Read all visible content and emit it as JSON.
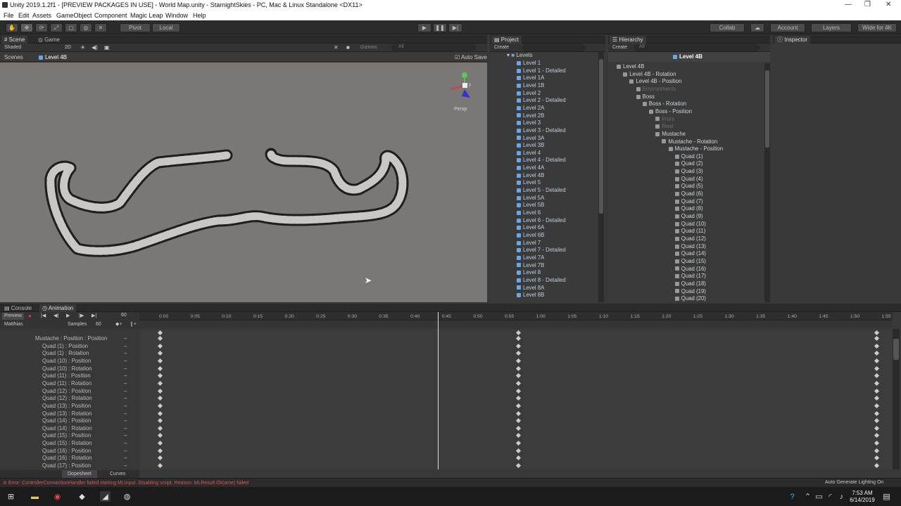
{
  "window": {
    "title": "Unity 2019.1.2f1 - [PREVIEW PACKAGES IN USE] - World Map.unity - StarnightSkies - PC, Mac & Linux Standalone <DX11>"
  },
  "menu": [
    "File",
    "Edit",
    "Assets",
    "GameObject",
    "Component",
    "Magic Leap",
    "Window",
    "Help"
  ],
  "toolbar": {
    "pivot": "Pivot",
    "local": "Local",
    "collab": "Collab",
    "account": "Account",
    "layers": "Layers",
    "layout": "Wide for 4K"
  },
  "scene": {
    "tabs": [
      "Scene",
      "Game"
    ],
    "shading": "Shaded",
    "mode2d": "2D",
    "gizmos": "Gizmos",
    "search": "All",
    "breadcrumb_root": "Scenes",
    "breadcrumb_current": "Level 4B",
    "autosave": "Auto Save",
    "persp": "Persp"
  },
  "project": {
    "tab": "Project",
    "create": "Create",
    "folder": "Levels",
    "items": [
      "Level 1",
      "Level 1 - Detailed",
      "Level 1A",
      "Level 1B",
      "Level 2",
      "Level 2 - Detailed",
      "Level 2A",
      "Level 2B",
      "Level 3",
      "Level 3 - Detailed",
      "Level 3A",
      "Level 3B",
      "Level 4",
      "Level 4 - Detailed",
      "Level 4A",
      "Level 4B",
      "Level 5",
      "Level 5 - Detailed",
      "Level 5A",
      "Level 5B",
      "Level 6",
      "Level 6 - Detailed",
      "Level 6A",
      "Level 6B",
      "Level 7",
      "Level 7 - Detailed",
      "Level 7A",
      "Level 7B",
      "Level 8",
      "Level 8 - Detailed",
      "Level 8A",
      "Level 8B"
    ]
  },
  "hierarchy": {
    "tab": "Hierarchy",
    "create": "Create",
    "search": "All",
    "header": "Level 4B",
    "items": [
      {
        "label": "Level 4B",
        "indent": 0,
        "dim": false
      },
      {
        "label": "Level 4B - Rotation",
        "indent": 1,
        "dim": false
      },
      {
        "label": "Level 4B - Position",
        "indent": 2,
        "dim": false
      },
      {
        "label": "Environments",
        "indent": 3,
        "dim": true
      },
      {
        "label": "Boss",
        "indent": 3,
        "dim": false
      },
      {
        "label": "Boss - Rotation",
        "indent": 4,
        "dim": false
      },
      {
        "label": "Boss - Position",
        "indent": 5,
        "dim": false
      },
      {
        "label": "Front",
        "indent": 6,
        "dim": true
      },
      {
        "label": "Rear",
        "indent": 6,
        "dim": true
      },
      {
        "label": "Mustache",
        "indent": 6,
        "dim": false
      },
      {
        "label": "Mustache - Rotation",
        "indent": 7,
        "dim": false
      },
      {
        "label": "Mustache - Position",
        "indent": 8,
        "dim": false
      },
      {
        "label": "Quad (1)",
        "indent": 9,
        "dim": false
      },
      {
        "label": "Quad (2)",
        "indent": 9,
        "dim": false
      },
      {
        "label": "Quad (3)",
        "indent": 9,
        "dim": false
      },
      {
        "label": "Quad (4)",
        "indent": 9,
        "dim": false
      },
      {
        "label": "Quad (5)",
        "indent": 9,
        "dim": false
      },
      {
        "label": "Quad (6)",
        "indent": 9,
        "dim": false
      },
      {
        "label": "Quad (7)",
        "indent": 9,
        "dim": false
      },
      {
        "label": "Quad (8)",
        "indent": 9,
        "dim": false
      },
      {
        "label": "Quad (9)",
        "indent": 9,
        "dim": false
      },
      {
        "label": "Quad (10)",
        "indent": 9,
        "dim": false
      },
      {
        "label": "Quad (11)",
        "indent": 9,
        "dim": false
      },
      {
        "label": "Quad (12)",
        "indent": 9,
        "dim": false
      },
      {
        "label": "Quad (13)",
        "indent": 9,
        "dim": false
      },
      {
        "label": "Quad (14)",
        "indent": 9,
        "dim": false
      },
      {
        "label": "Quad (15)",
        "indent": 9,
        "dim": false
      },
      {
        "label": "Quad (16)",
        "indent": 9,
        "dim": false
      },
      {
        "label": "Quad (17)",
        "indent": 9,
        "dim": false
      },
      {
        "label": "Quad (18)",
        "indent": 9,
        "dim": false
      },
      {
        "label": "Quad (19)",
        "indent": 9,
        "dim": false
      },
      {
        "label": "Quad (20)",
        "indent": 9,
        "dim": false
      }
    ]
  },
  "inspector": {
    "tab": "Inspector"
  },
  "animation": {
    "tabs": [
      "Console",
      "Animation"
    ],
    "preview": "Preview",
    "frame": "60",
    "clip": "Matthias",
    "samples_label": "Samples",
    "samples": "60",
    "tracks": [
      "Mustache : Position : Position",
      "Quad (1) : Position",
      "Quad (1) : Rotation",
      "Quad (10) : Position",
      "Quad (10) : Rotation",
      "Quad (11) : Position",
      "Quad (11) : Rotation",
      "Quad (12) : Position",
      "Quad (12) : Rotation",
      "Quad (13) : Position",
      "Quad (13) : Rotation",
      "Quad (14) : Position",
      "Quad (14) : Rotation",
      "Quad (15) : Position",
      "Quad (15) : Rotation",
      "Quad (16) : Position",
      "Quad (16) : Rotation",
      "Quad (17) : Position"
    ],
    "ticks": [
      "0:00",
      "0:05",
      "0:10",
      "0:15",
      "0:20",
      "0:25",
      "0:30",
      "0:35",
      "0:40",
      "0:45",
      "0:50",
      "0:55",
      "1:00",
      "1:05",
      "1:10",
      "1:15",
      "1:20",
      "1:25",
      "1:30",
      "1:35",
      "1:40",
      "1:45",
      "1:50",
      "1:55"
    ],
    "dopesheet": "Dopesheet",
    "curves": "Curves"
  },
  "status": {
    "error": "Error: ControllerConnectionHandler failed starting MLInput. Disabling script. Reason: MLResult.Ok(ame) failed",
    "right": "Auto Generate Lighting On"
  },
  "taskbar": {
    "time": "7:53 AM",
    "date": "6/14/2019"
  }
}
